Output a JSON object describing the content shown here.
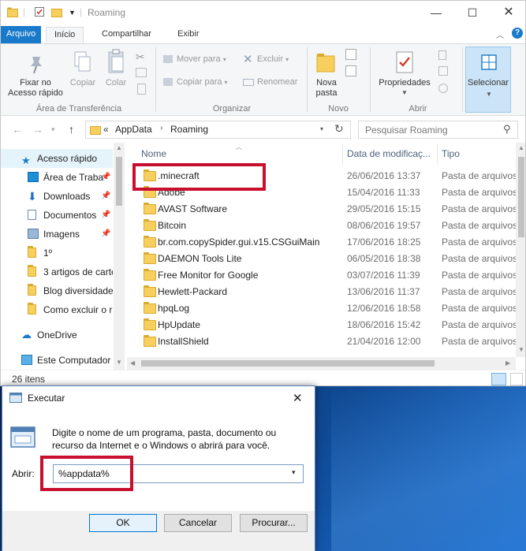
{
  "explorer": {
    "title": "Roaming",
    "ribbon_tabs": [
      "Arquivo",
      "Início",
      "Compartilhar",
      "Exibir"
    ],
    "ribbon": {
      "fixar": "Fixar no\nAcesso rápido",
      "copiar": "Copiar",
      "colar": "Colar",
      "clipboard_group": "Área de Transferência",
      "mover_para": "Mover para",
      "copiar_para": "Copiar para",
      "excluir": "Excluir",
      "renomear": "Renomear",
      "organizar_group": "Organizar",
      "nova_pasta": "Nova\npasta",
      "novo_group": "Novo",
      "propriedades": "Propriedades",
      "abrir_group": "Abrir",
      "selecionar": "Selecionar"
    },
    "address": {
      "prefix": "«",
      "path": [
        "AppData",
        "Roaming"
      ]
    },
    "search_placeholder": "Pesquisar Roaming",
    "nav_items": [
      {
        "label": "Acesso rápido",
        "icon": "star-icon",
        "pinned": false
      },
      {
        "label": "Área de Traba",
        "icon": "desktop-icon",
        "pinned": true
      },
      {
        "label": "Downloads",
        "icon": "download-icon",
        "pinned": true
      },
      {
        "label": "Documentos",
        "icon": "document-icon",
        "pinned": true
      },
      {
        "label": "Imagens",
        "icon": "image-icon",
        "pinned": true
      },
      {
        "label": "1º",
        "icon": "folder-icon",
        "pinned": false
      },
      {
        "label": "3 artigos de carte",
        "icon": "folder-icon",
        "pinned": false
      },
      {
        "label": "Blog diversidade",
        "icon": "folder-icon",
        "pinned": false
      },
      {
        "label": "Como excluir o r",
        "icon": "folder-icon",
        "pinned": false
      },
      {
        "label": "OneDrive",
        "icon": "cloud-icon",
        "pinned": false
      },
      {
        "label": "Este Computador",
        "icon": "computer-icon",
        "pinned": false
      }
    ],
    "pin_glyph": "📌",
    "columns": {
      "name": "Nome",
      "date": "Data de modificaç...",
      "type": "Tipo"
    },
    "files": [
      {
        "name": ".minecraft",
        "date": "26/06/2016 13:37",
        "type": "Pasta de arquivos"
      },
      {
        "name": "Adobe",
        "date": "15/04/2016 11:33",
        "type": "Pasta de arquivos"
      },
      {
        "name": "AVAST Software",
        "date": "29/05/2016 15:15",
        "type": "Pasta de arquivos"
      },
      {
        "name": "Bitcoin",
        "date": "08/06/2016 19:57",
        "type": "Pasta de arquivos"
      },
      {
        "name": "br.com.copySpider.gui.v15.CSGuiMain",
        "date": "17/06/2016 18:25",
        "type": "Pasta de arquivos"
      },
      {
        "name": "DAEMON Tools Lite",
        "date": "06/05/2016 18:38",
        "type": "Pasta de arquivos"
      },
      {
        "name": "Free Monitor for Google",
        "date": "03/07/2016 11:39",
        "type": "Pasta de arquivos"
      },
      {
        "name": "Hewlett-Packard",
        "date": "13/06/2016 11:37",
        "type": "Pasta de arquivos"
      },
      {
        "name": "hpqLog",
        "date": "12/06/2016 18:58",
        "type": "Pasta de arquivos"
      },
      {
        "name": "HpUpdate",
        "date": "18/06/2016 15:42",
        "type": "Pasta de arquivos"
      },
      {
        "name": "InstallShield",
        "date": "21/04/2016 12:00",
        "type": "Pasta de arquivos"
      }
    ],
    "status": "26 itens"
  },
  "run_dialog": {
    "title": "Executar",
    "description": "Digite o nome de um programa, pasta, documento ou recurso da Internet e o Windows o abrirá para você.",
    "open_label": "Abrir:",
    "open_value": "%appdata%",
    "ok": "OK",
    "cancel": "Cancelar",
    "browse": "Procurar..."
  },
  "colors": {
    "accent": "#1979ca",
    "highlight_box": "#c8102e",
    "folder": "#f6cf5e"
  }
}
